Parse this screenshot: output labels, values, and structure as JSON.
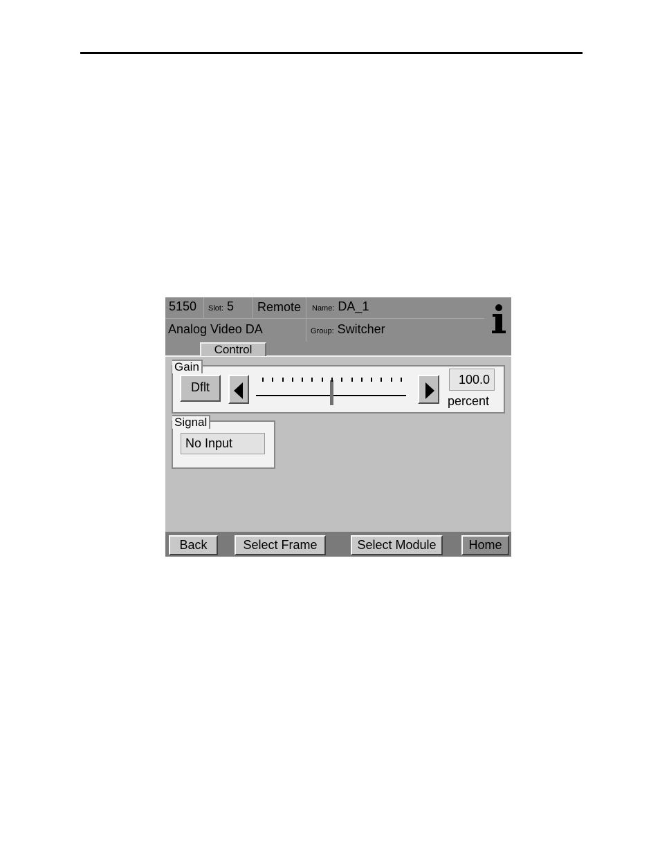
{
  "header": {
    "model": "5150",
    "slot_label": "Slot:",
    "slot_value": "5",
    "mode": "Remote",
    "name_label": "Name:",
    "name_value": "DA_1",
    "module_type": "Analog Video DA",
    "group_label": "Group:",
    "group_value": "Switcher",
    "info_icon": "info-icon"
  },
  "tabs": [
    {
      "label": "Control",
      "selected": true
    }
  ],
  "gain": {
    "title": "Gain",
    "default_button": "Dflt",
    "value": "100.0",
    "unit": "percent",
    "slider_position": 0.5,
    "tick_count": 15
  },
  "signal": {
    "title": "Signal",
    "status": "No Input"
  },
  "footer": {
    "back": "Back",
    "select_frame": "Select Frame",
    "select_module": "Select Module",
    "home": "Home"
  },
  "colors": {
    "header_bg": "#8c8c8c",
    "panel_bg": "#c0c0c0",
    "group_bg": "#f2f2f2",
    "footer_bg": "#7a7a7a"
  }
}
